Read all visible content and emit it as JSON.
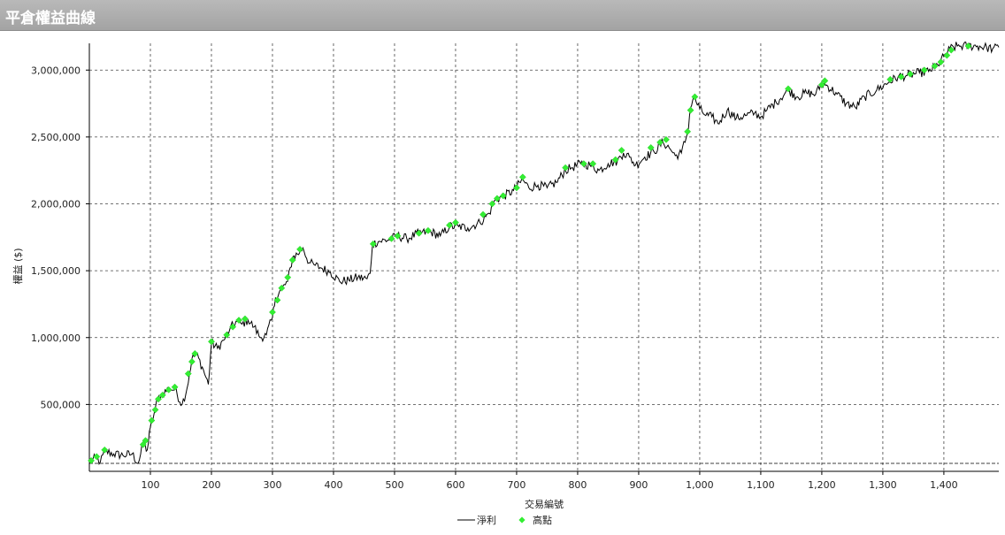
{
  "window": {
    "title": "平倉權益曲線"
  },
  "colors": {
    "line": "#000000",
    "marker": "#33ee33",
    "grid": "#444444",
    "header": "#a9a9a9"
  },
  "chart_data": {
    "type": "line",
    "title": "",
    "xlabel": "交易編號",
    "ylabel": "權益 ($)",
    "xlim": [
      0,
      1490
    ],
    "ylim": [
      0,
      3200000
    ],
    "x_ticks": [
      100,
      200,
      300,
      400,
      500,
      600,
      700,
      800,
      900,
      1000,
      1100,
      1200,
      1300,
      1400
    ],
    "x_tick_labels": [
      "100",
      "200",
      "300",
      "400",
      "500",
      "600",
      "700",
      "800",
      "900",
      "1,000",
      "1,100",
      "1,200",
      "1,300",
      "1,400"
    ],
    "y_ticks": [
      500000,
      1000000,
      1500000,
      2000000,
      2500000,
      3000000
    ],
    "y_tick_labels": [
      "500,000",
      "1,000,000",
      "1,500,000",
      "2,000,000",
      "2,500,000",
      "3,000,000"
    ],
    "grid": true,
    "legend_position": "bottom-center",
    "series": [
      {
        "name": "淨利",
        "type": "line",
        "points": [
          [
            0,
            60000
          ],
          [
            10,
            100000
          ],
          [
            18,
            70000
          ],
          [
            26,
            150000
          ],
          [
            40,
            130000
          ],
          [
            55,
            120000
          ],
          [
            70,
            130000
          ],
          [
            80,
            60000
          ],
          [
            88,
            200000
          ],
          [
            95,
            160000
          ],
          [
            100,
            330000
          ],
          [
            106,
            430000
          ],
          [
            112,
            540000
          ],
          [
            120,
            580000
          ],
          [
            130,
            620000
          ],
          [
            140,
            610000
          ],
          [
            152,
            500000
          ],
          [
            160,
            620000
          ],
          [
            168,
            840000
          ],
          [
            175,
            880000
          ],
          [
            185,
            780000
          ],
          [
            195,
            650000
          ],
          [
            200,
            960000
          ],
          [
            210,
            920000
          ],
          [
            220,
            980000
          ],
          [
            230,
            1060000
          ],
          [
            240,
            1120000
          ],
          [
            250,
            1100000
          ],
          [
            260,
            1130000
          ],
          [
            270,
            1080000
          ],
          [
            280,
            1000000
          ],
          [
            290,
            1020000
          ],
          [
            300,
            1150000
          ],
          [
            305,
            1300000
          ],
          [
            315,
            1360000
          ],
          [
            325,
            1420000
          ],
          [
            333,
            1600000
          ],
          [
            345,
            1640000
          ],
          [
            350,
            1670000
          ],
          [
            360,
            1560000
          ],
          [
            370,
            1540000
          ],
          [
            380,
            1520000
          ],
          [
            395,
            1490000
          ],
          [
            410,
            1420000
          ],
          [
            425,
            1430000
          ],
          [
            440,
            1450000
          ],
          [
            455,
            1440000
          ],
          [
            460,
            1480000
          ],
          [
            464,
            1700000
          ],
          [
            475,
            1720000
          ],
          [
            490,
            1730000
          ],
          [
            505,
            1760000
          ],
          [
            520,
            1740000
          ],
          [
            540,
            1780000
          ],
          [
            560,
            1790000
          ],
          [
            575,
            1760000
          ],
          [
            590,
            1830000
          ],
          [
            605,
            1830000
          ],
          [
            620,
            1820000
          ],
          [
            640,
            1860000
          ],
          [
            655,
            1930000
          ],
          [
            665,
            2030000
          ],
          [
            680,
            2060000
          ],
          [
            695,
            2100000
          ],
          [
            710,
            2180000
          ],
          [
            720,
            2120000
          ],
          [
            735,
            2140000
          ],
          [
            750,
            2120000
          ],
          [
            765,
            2160000
          ],
          [
            780,
            2250000
          ],
          [
            790,
            2270000
          ],
          [
            805,
            2300000
          ],
          [
            820,
            2290000
          ],
          [
            835,
            2250000
          ],
          [
            850,
            2300000
          ],
          [
            865,
            2320000
          ],
          [
            875,
            2380000
          ],
          [
            885,
            2350000
          ],
          [
            895,
            2290000
          ],
          [
            910,
            2350000
          ],
          [
            925,
            2390000
          ],
          [
            940,
            2460000
          ],
          [
            950,
            2420000
          ],
          [
            960,
            2360000
          ],
          [
            970,
            2380000
          ],
          [
            980,
            2530000
          ],
          [
            985,
            2720000
          ],
          [
            990,
            2800000
          ],
          [
            1000,
            2710000
          ],
          [
            1010,
            2660000
          ],
          [
            1020,
            2650000
          ],
          [
            1030,
            2600000
          ],
          [
            1045,
            2700000
          ],
          [
            1060,
            2640000
          ],
          [
            1075,
            2660000
          ],
          [
            1090,
            2680000
          ],
          [
            1100,
            2650000
          ],
          [
            1110,
            2700000
          ],
          [
            1125,
            2760000
          ],
          [
            1145,
            2850000
          ],
          [
            1160,
            2800000
          ],
          [
            1175,
            2830000
          ],
          [
            1190,
            2820000
          ],
          [
            1200,
            2900000
          ],
          [
            1210,
            2880000
          ],
          [
            1225,
            2820000
          ],
          [
            1240,
            2750000
          ],
          [
            1255,
            2720000
          ],
          [
            1270,
            2800000
          ],
          [
            1290,
            2850000
          ],
          [
            1310,
            2910000
          ],
          [
            1325,
            2950000
          ],
          [
            1340,
            2960000
          ],
          [
            1360,
            2980000
          ],
          [
            1375,
            2990000
          ],
          [
            1390,
            3040000
          ],
          [
            1400,
            3100000
          ],
          [
            1410,
            3160000
          ],
          [
            1422,
            3180000
          ],
          [
            1440,
            3180000
          ],
          [
            1455,
            3180000
          ],
          [
            1470,
            3170000
          ],
          [
            1480,
            3160000
          ],
          [
            1490,
            3170000
          ]
        ]
      },
      {
        "name": "高點",
        "type": "scatter",
        "points": [
          [
            3,
            80000
          ],
          [
            12,
            110000
          ],
          [
            25,
            160000
          ],
          [
            88,
            200000
          ],
          [
            92,
            230000
          ],
          [
            102,
            380000
          ],
          [
            108,
            460000
          ],
          [
            113,
            540000
          ],
          [
            120,
            570000
          ],
          [
            130,
            610000
          ],
          [
            140,
            630000
          ],
          [
            162,
            730000
          ],
          [
            168,
            820000
          ],
          [
            173,
            880000
          ],
          [
            200,
            970000
          ],
          [
            225,
            1020000
          ],
          [
            235,
            1080000
          ],
          [
            245,
            1130000
          ],
          [
            255,
            1140000
          ],
          [
            300,
            1190000
          ],
          [
            308,
            1280000
          ],
          [
            315,
            1370000
          ],
          [
            325,
            1450000
          ],
          [
            333,
            1580000
          ],
          [
            345,
            1660000
          ],
          [
            465,
            1700000
          ],
          [
            495,
            1740000
          ],
          [
            505,
            1760000
          ],
          [
            540,
            1780000
          ],
          [
            555,
            1800000
          ],
          [
            590,
            1840000
          ],
          [
            600,
            1860000
          ],
          [
            645,
            1920000
          ],
          [
            660,
            2000000
          ],
          [
            668,
            2040000
          ],
          [
            678,
            2060000
          ],
          [
            700,
            2120000
          ],
          [
            710,
            2200000
          ],
          [
            780,
            2270000
          ],
          [
            810,
            2300000
          ],
          [
            825,
            2300000
          ],
          [
            862,
            2330000
          ],
          [
            872,
            2400000
          ],
          [
            920,
            2420000
          ],
          [
            935,
            2460000
          ],
          [
            945,
            2480000
          ],
          [
            980,
            2540000
          ],
          [
            985,
            2700000
          ],
          [
            992,
            2800000
          ],
          [
            1145,
            2860000
          ],
          [
            1200,
            2890000
          ],
          [
            1205,
            2920000
          ],
          [
            1312,
            2930000
          ],
          [
            1330,
            2950000
          ],
          [
            1345,
            2970000
          ],
          [
            1368,
            3000000
          ],
          [
            1385,
            3030000
          ],
          [
            1395,
            3060000
          ],
          [
            1405,
            3110000
          ],
          [
            1412,
            3150000
          ],
          [
            1440,
            3180000
          ]
        ]
      }
    ]
  },
  "legend": {
    "line_label": "淨利",
    "marker_label": "高點"
  }
}
